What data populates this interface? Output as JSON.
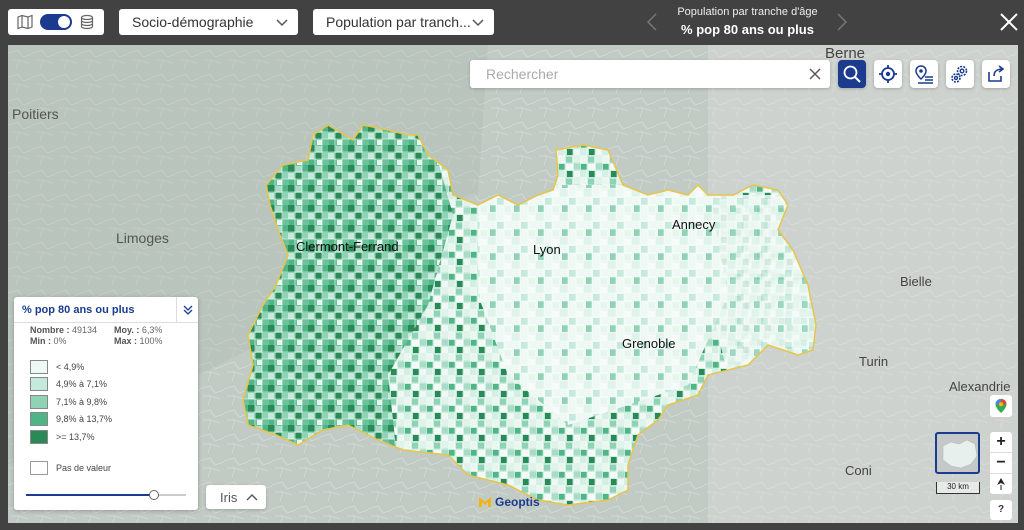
{
  "toolbar": {
    "category_select": "Socio-démographie",
    "indicator_select": "Population par tranch..."
  },
  "indicator_title": {
    "subtitle": "Population par tranche d'âge",
    "title": "% pop 80 ans ou plus"
  },
  "search": {
    "placeholder": "Rechercher"
  },
  "cities": {
    "berne": "Berne",
    "poitiers": "Poitiers",
    "limoges": "Limoges",
    "clermont": "Clermont-Ferrand",
    "lyon": "Lyon",
    "annecy": "Annecy",
    "grenoble": "Grenoble",
    "bielle": "Bielle",
    "turin": "Turin",
    "alexandrie": "Alexandrie",
    "coni": "Coni"
  },
  "legend": {
    "title": "% pop 80 ans ou plus",
    "nombre_label": "Nombre :",
    "nombre_value": "49134",
    "moy_label": "Moy. :",
    "moy_value": "6,3%",
    "min_label": "Min :",
    "min_value": "0%",
    "max_label": "Max :",
    "max_value": "100%",
    "classes": [
      {
        "label": "< 4,9%",
        "color": "#eef8f4"
      },
      {
        "label": "4,9% à 7,1%",
        "color": "#c5e9dc"
      },
      {
        "label": "7,1% à 9,8%",
        "color": "#8fd3b7"
      },
      {
        "label": "9,8% à 13,7%",
        "color": "#4fb587"
      },
      {
        "label": ">= 13,7%",
        "color": "#2a8a57"
      }
    ],
    "no_value_label": "Pas de valeur",
    "opacity_fraction": 0.8
  },
  "geo_level": {
    "label": "Iris"
  },
  "brand": {
    "name": "Geoptis"
  },
  "scale": {
    "label": "30 km"
  },
  "zoom": {
    "in": "+",
    "out": "−"
  },
  "help": {
    "label": "?"
  },
  "colors": {
    "accent": "#1a3b8e",
    "region_border": "#e8c44a",
    "background_bar": "#424242"
  }
}
